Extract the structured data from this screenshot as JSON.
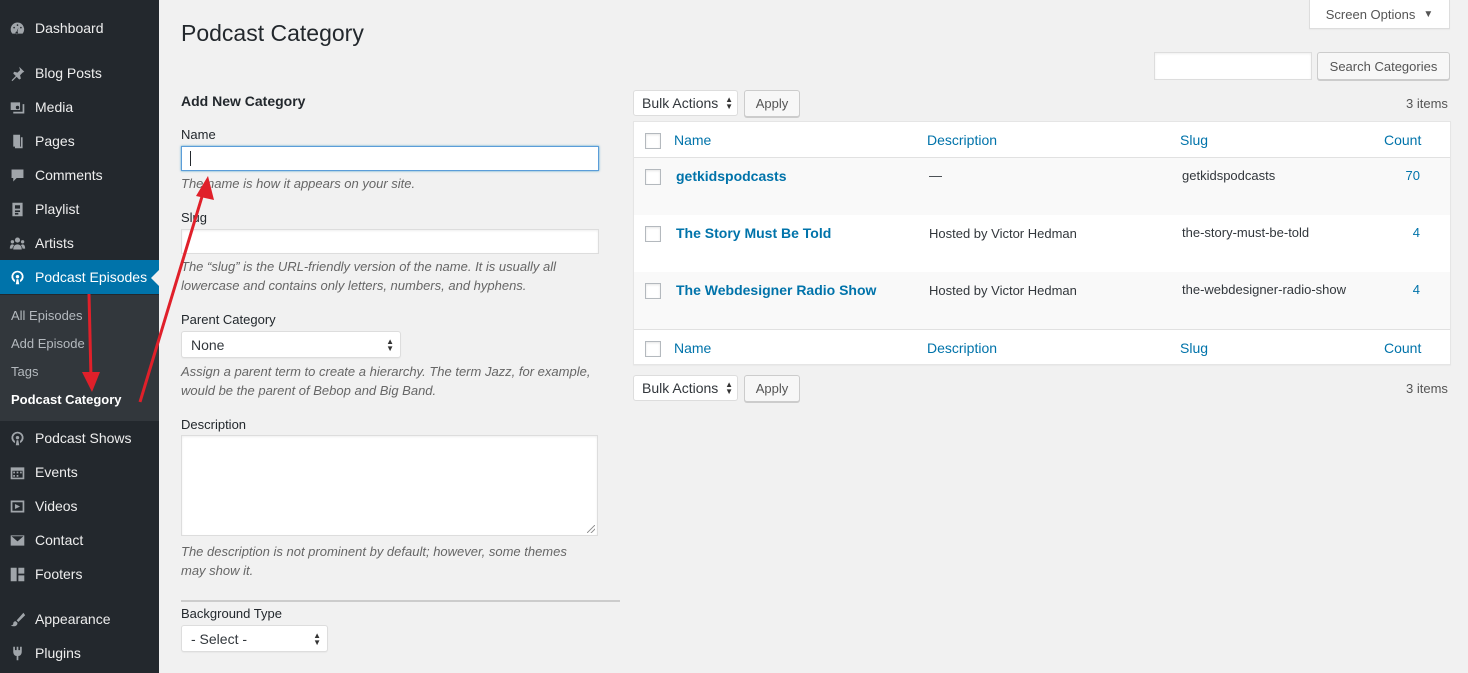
{
  "sidebar": {
    "items": [
      {
        "label": "Dashboard",
        "icon": "dashboard-icon"
      },
      {
        "label": "Blog Posts",
        "icon": "pin-icon"
      },
      {
        "label": "Media",
        "icon": "media-icon"
      },
      {
        "label": "Pages",
        "icon": "page-icon"
      },
      {
        "label": "Comments",
        "icon": "comment-icon"
      },
      {
        "label": "Playlist",
        "icon": "playlist-icon"
      },
      {
        "label": "Artists",
        "icon": "groups-icon"
      },
      {
        "label": "Podcast Episodes",
        "icon": "podcast-icon"
      },
      {
        "label": "Podcast Shows",
        "icon": "podcast-icon"
      },
      {
        "label": "Events",
        "icon": "calendar-icon"
      },
      {
        "label": "Videos",
        "icon": "video-icon"
      },
      {
        "label": "Contact",
        "icon": "email-icon"
      },
      {
        "label": "Footers",
        "icon": "layout-icon"
      },
      {
        "label": "Appearance",
        "icon": "brush-icon"
      },
      {
        "label": "Plugins",
        "icon": "plugin-icon"
      }
    ],
    "submenu": [
      "All Episodes",
      "Add Episode",
      "Tags",
      "Podcast Category"
    ]
  },
  "header": {
    "screen_options": "Screen Options",
    "title": "Podcast Category"
  },
  "search": {
    "value": "",
    "button": "Search Categories"
  },
  "form": {
    "heading": "Add New Category",
    "name_label": "Name",
    "name_value": "",
    "name_help": "The name is how it appears on your site.",
    "slug_label": "Slug",
    "slug_value": "",
    "slug_help_1": "The “slug” is the URL-friendly version of the name. It is usually all",
    "slug_help_2": "lowercase and contains only letters, numbers, and hyphens.",
    "parent_label": "Parent Category",
    "parent_value": "None",
    "parent_help_1": "Assign a parent term to create a hierarchy. The term Jazz, for example,",
    "parent_help_2": "would be the parent of Bebop and Big Band.",
    "description_label": "Description",
    "description_value": "",
    "description_help_1": "The description is not prominent by default; however, some themes",
    "description_help_2": "may show it.",
    "background_label": "Background Type",
    "background_value": "- Select -"
  },
  "list": {
    "bulk_actions": "Bulk Actions",
    "apply": "Apply",
    "items_count": "3 items",
    "columns": {
      "name": "Name",
      "description": "Description",
      "slug": "Slug",
      "count": "Count"
    },
    "rows": [
      {
        "name": "getkidspodcasts",
        "description": "—",
        "slug": "getkidspodcasts",
        "count": "70"
      },
      {
        "name": "The Story Must Be Told",
        "description": "Hosted by Victor Hedman",
        "slug": "the-story-must-be-told",
        "count": "4"
      },
      {
        "name": "The Webdesigner Radio Show",
        "description": "Hosted by Victor Hedman",
        "slug": "the-webdesigner-radio-show",
        "count": "4"
      }
    ]
  },
  "colors": {
    "sidebar_bg": "#23282d",
    "accent": "#0073aa",
    "annotation_arrow": "#e0202a"
  }
}
